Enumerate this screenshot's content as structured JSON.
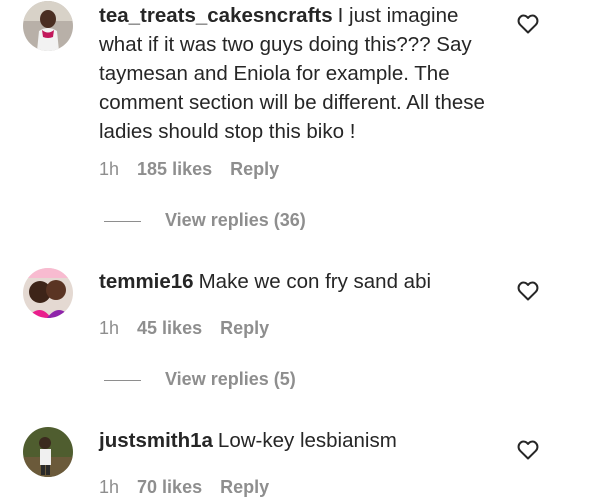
{
  "comments": [
    {
      "username": "tea_treats_cakesncrafts",
      "text": "I just imagine what if it was two guys doing this??? Say taymesan and Eniola for example. The comment section will be different. All these ladies should stop this biko !",
      "time": "1h",
      "likes": "185 likes",
      "reply_label": "Reply",
      "view_replies": "View replies (36)",
      "avatar_icon": "profile-photo"
    },
    {
      "username": "temmie16",
      "text": "Make we con fry sand abi",
      "time": "1h",
      "likes": "45 likes",
      "reply_label": "Reply",
      "view_replies": "View replies (5)",
      "avatar_icon": "profile-photo"
    },
    {
      "username": "justsmith1a",
      "text": "Low-key lesbianism",
      "time": "1h",
      "likes": "70 likes",
      "reply_label": "Reply",
      "avatar_icon": "profile-photo"
    }
  ],
  "icons": {
    "like": "heart-outline-icon"
  },
  "colors": {
    "text": "#262626",
    "muted": "#8e8e8e",
    "background": "#ffffff"
  }
}
